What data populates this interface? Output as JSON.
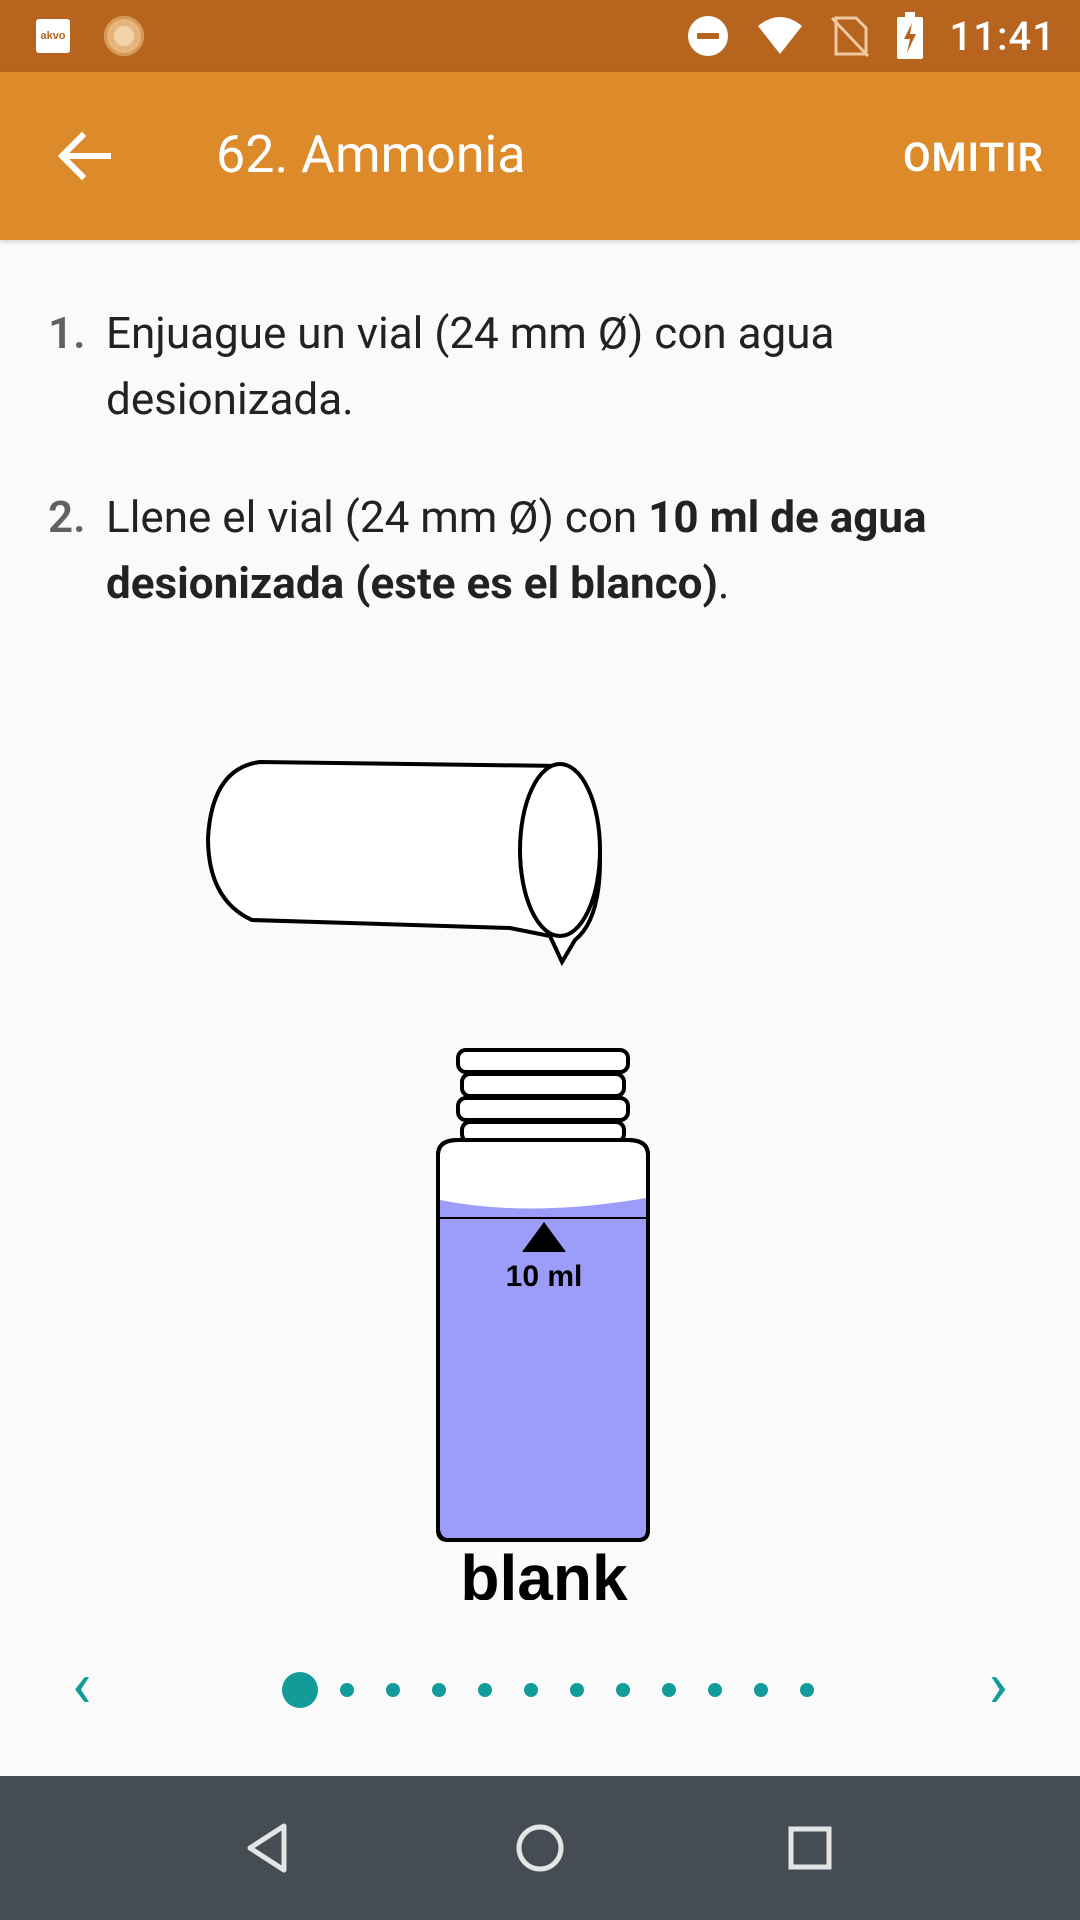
{
  "status_bar": {
    "left_icons": [
      "akvo-app-icon",
      "sun-app-icon"
    ],
    "akvo_label": "akvo",
    "right_icons": [
      "do-not-disturb-icon",
      "wifi-icon",
      "no-sim-icon",
      "battery-charging-icon"
    ],
    "time": "11:41"
  },
  "app_bar": {
    "back_icon": "arrow-left-icon",
    "title": "62. Ammonia",
    "skip_label": "OMITIR"
  },
  "steps": [
    {
      "number": "1.",
      "text": "Enjuague un vial (24 mm Ø) con agua desionizada."
    },
    {
      "number": "2.",
      "text_prefix": "Llene el vial (24 mm Ø) con ",
      "text_bold": "10 ml de agua desionizada (este es el blanco)",
      "text_suffix": "."
    }
  ],
  "illustration": {
    "volume_label": "10 ml",
    "caption": "blank",
    "liquid_color": "#9c9cf9"
  },
  "pager": {
    "prev_icon": "chevron-left-icon",
    "next_icon": "chevron-right-icon",
    "total_pages": 12,
    "current_page": 1,
    "accent_color": "#119c99"
  },
  "nav_bar": {
    "icons": [
      "back-triangle-icon",
      "home-circle-icon",
      "recents-square-icon"
    ]
  }
}
